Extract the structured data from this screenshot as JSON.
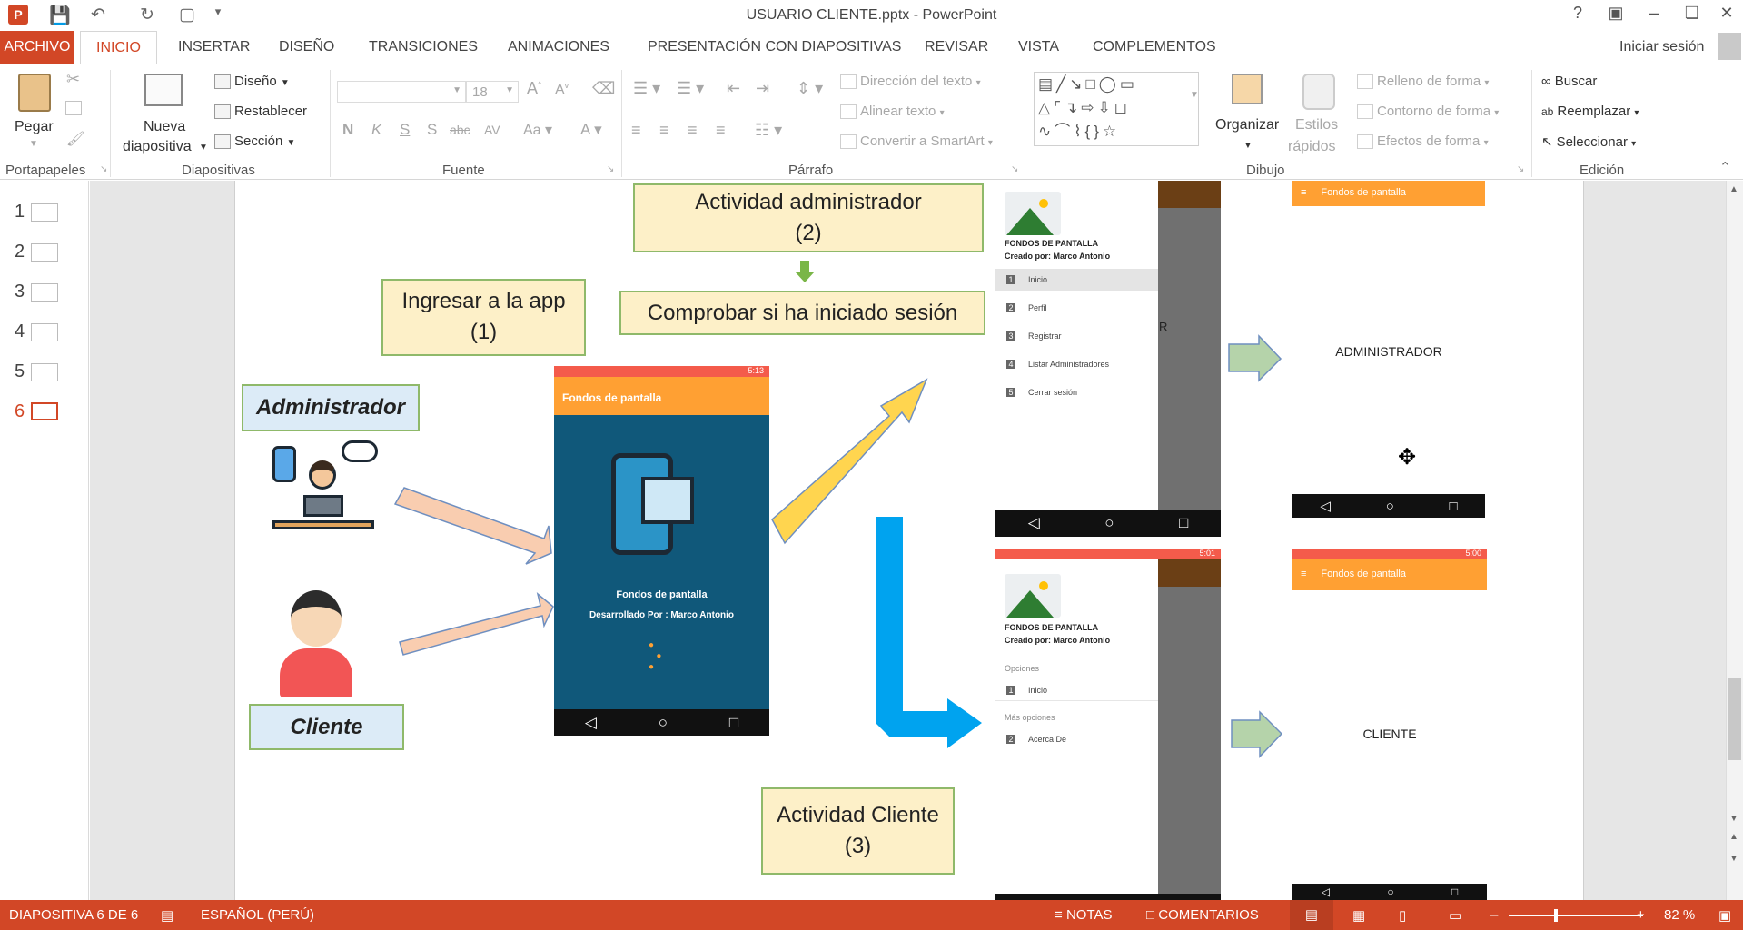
{
  "app": {
    "title": "USUARIO CLIENTE.pptx - PowerPoint"
  },
  "titlebar": {
    "help": "?",
    "sign_in": "Iniciar sesión"
  },
  "tabs": [
    "ARCHIVO",
    "INICIO",
    "INSERTAR",
    "DISEÑO",
    "TRANSICIONES",
    "ANIMACIONES",
    "PRESENTACIÓN CON DIAPOSITIVAS",
    "REVISAR",
    "VISTA",
    "COMPLEMENTOS"
  ],
  "ribbon": {
    "portapapeles": {
      "label": "Portapapeles",
      "paste": "Pegar"
    },
    "diapositivas": {
      "label": "Diapositivas",
      "new_slide_1": "Nueva",
      "new_slide_2": "diapositiva",
      "layout": "Diseño",
      "reset": "Restablecer",
      "section": "Sección"
    },
    "fuente": {
      "label": "Fuente",
      "font_size": "18"
    },
    "parrafo": {
      "label": "Párrafo",
      "text_direction": "Dirección del texto",
      "align_text": "Alinear texto",
      "smartart": "Convertir a SmartArt"
    },
    "dibujo": {
      "label": "Dibujo",
      "arrange": "Organizar",
      "quick_styles_1": "Estilos",
      "quick_styles_2": "rápidos",
      "fill": "Relleno de forma",
      "outline": "Contorno de forma",
      "effects": "Efectos de forma"
    },
    "edicion": {
      "label": "Edición",
      "find": "Buscar",
      "replace": "Reemplazar",
      "select": "Seleccionar"
    }
  },
  "thumbnails": [
    "1",
    "2",
    "3",
    "4",
    "5",
    "6"
  ],
  "slide": {
    "admin_activity": "Actividad administrador\n(2)",
    "check_session": "Comprobar si ha iniciado sesión",
    "enter_app": "Ingresar a la app\n(1)",
    "admin_label": "Administrador",
    "client_label": "Cliente",
    "client_activity": "Actividad Cliente\n(3)",
    "splash": {
      "appbar": "Fondos de pantalla",
      "time": "5:13",
      "title": "Fondos de pantalla",
      "subtitle": "Desarrollado Por : Marco Antonio"
    },
    "admin_drawer": {
      "title": "FONDOS DE PANTALLA",
      "author": "Creado por: Marco Antonio",
      "items": [
        {
          "n": "1",
          "t": "Inicio"
        },
        {
          "n": "2",
          "t": "Perfil"
        },
        {
          "n": "3",
          "t": "Registrar"
        },
        {
          "n": "4",
          "t": "Listar Administradores"
        },
        {
          "n": "5",
          "t": "Cerrar sesión"
        }
      ],
      "peek": "R"
    },
    "admin_screen": {
      "appbar": "Fondos de pantalla",
      "text": "ADMINISTRADOR"
    },
    "client_drawer": {
      "title": "FONDOS DE PANTALLA",
      "author": "Creado por: Marco Antonio",
      "time": "5:01",
      "section1": "Opciones",
      "item1": {
        "n": "1",
        "t": "Inicio"
      },
      "section2": "Más opciones",
      "item2": {
        "n": "2",
        "t": "Acerca De"
      }
    },
    "client_screen": {
      "appbar": "Fondos de pantalla",
      "time": "5:00",
      "text": "CLIENTE"
    }
  },
  "statusbar": {
    "slide_info": "DIAPOSITIVA 6 DE 6",
    "language": "ESPAÑOL (PERÚ)",
    "notes": "NOTAS",
    "comments": "COMENTARIOS",
    "zoom": "82 %"
  },
  "colors": {
    "accent": "#d24726",
    "appbar": "#ffa033",
    "splash_bg": "#10587a",
    "phone_status": "#f45b4b",
    "yellow_arrow": "#ffd54f",
    "blue_arrow": "#00a3ef",
    "pink_arrow": "#f9cdb0",
    "green_arrow": "#b5d3aa"
  }
}
